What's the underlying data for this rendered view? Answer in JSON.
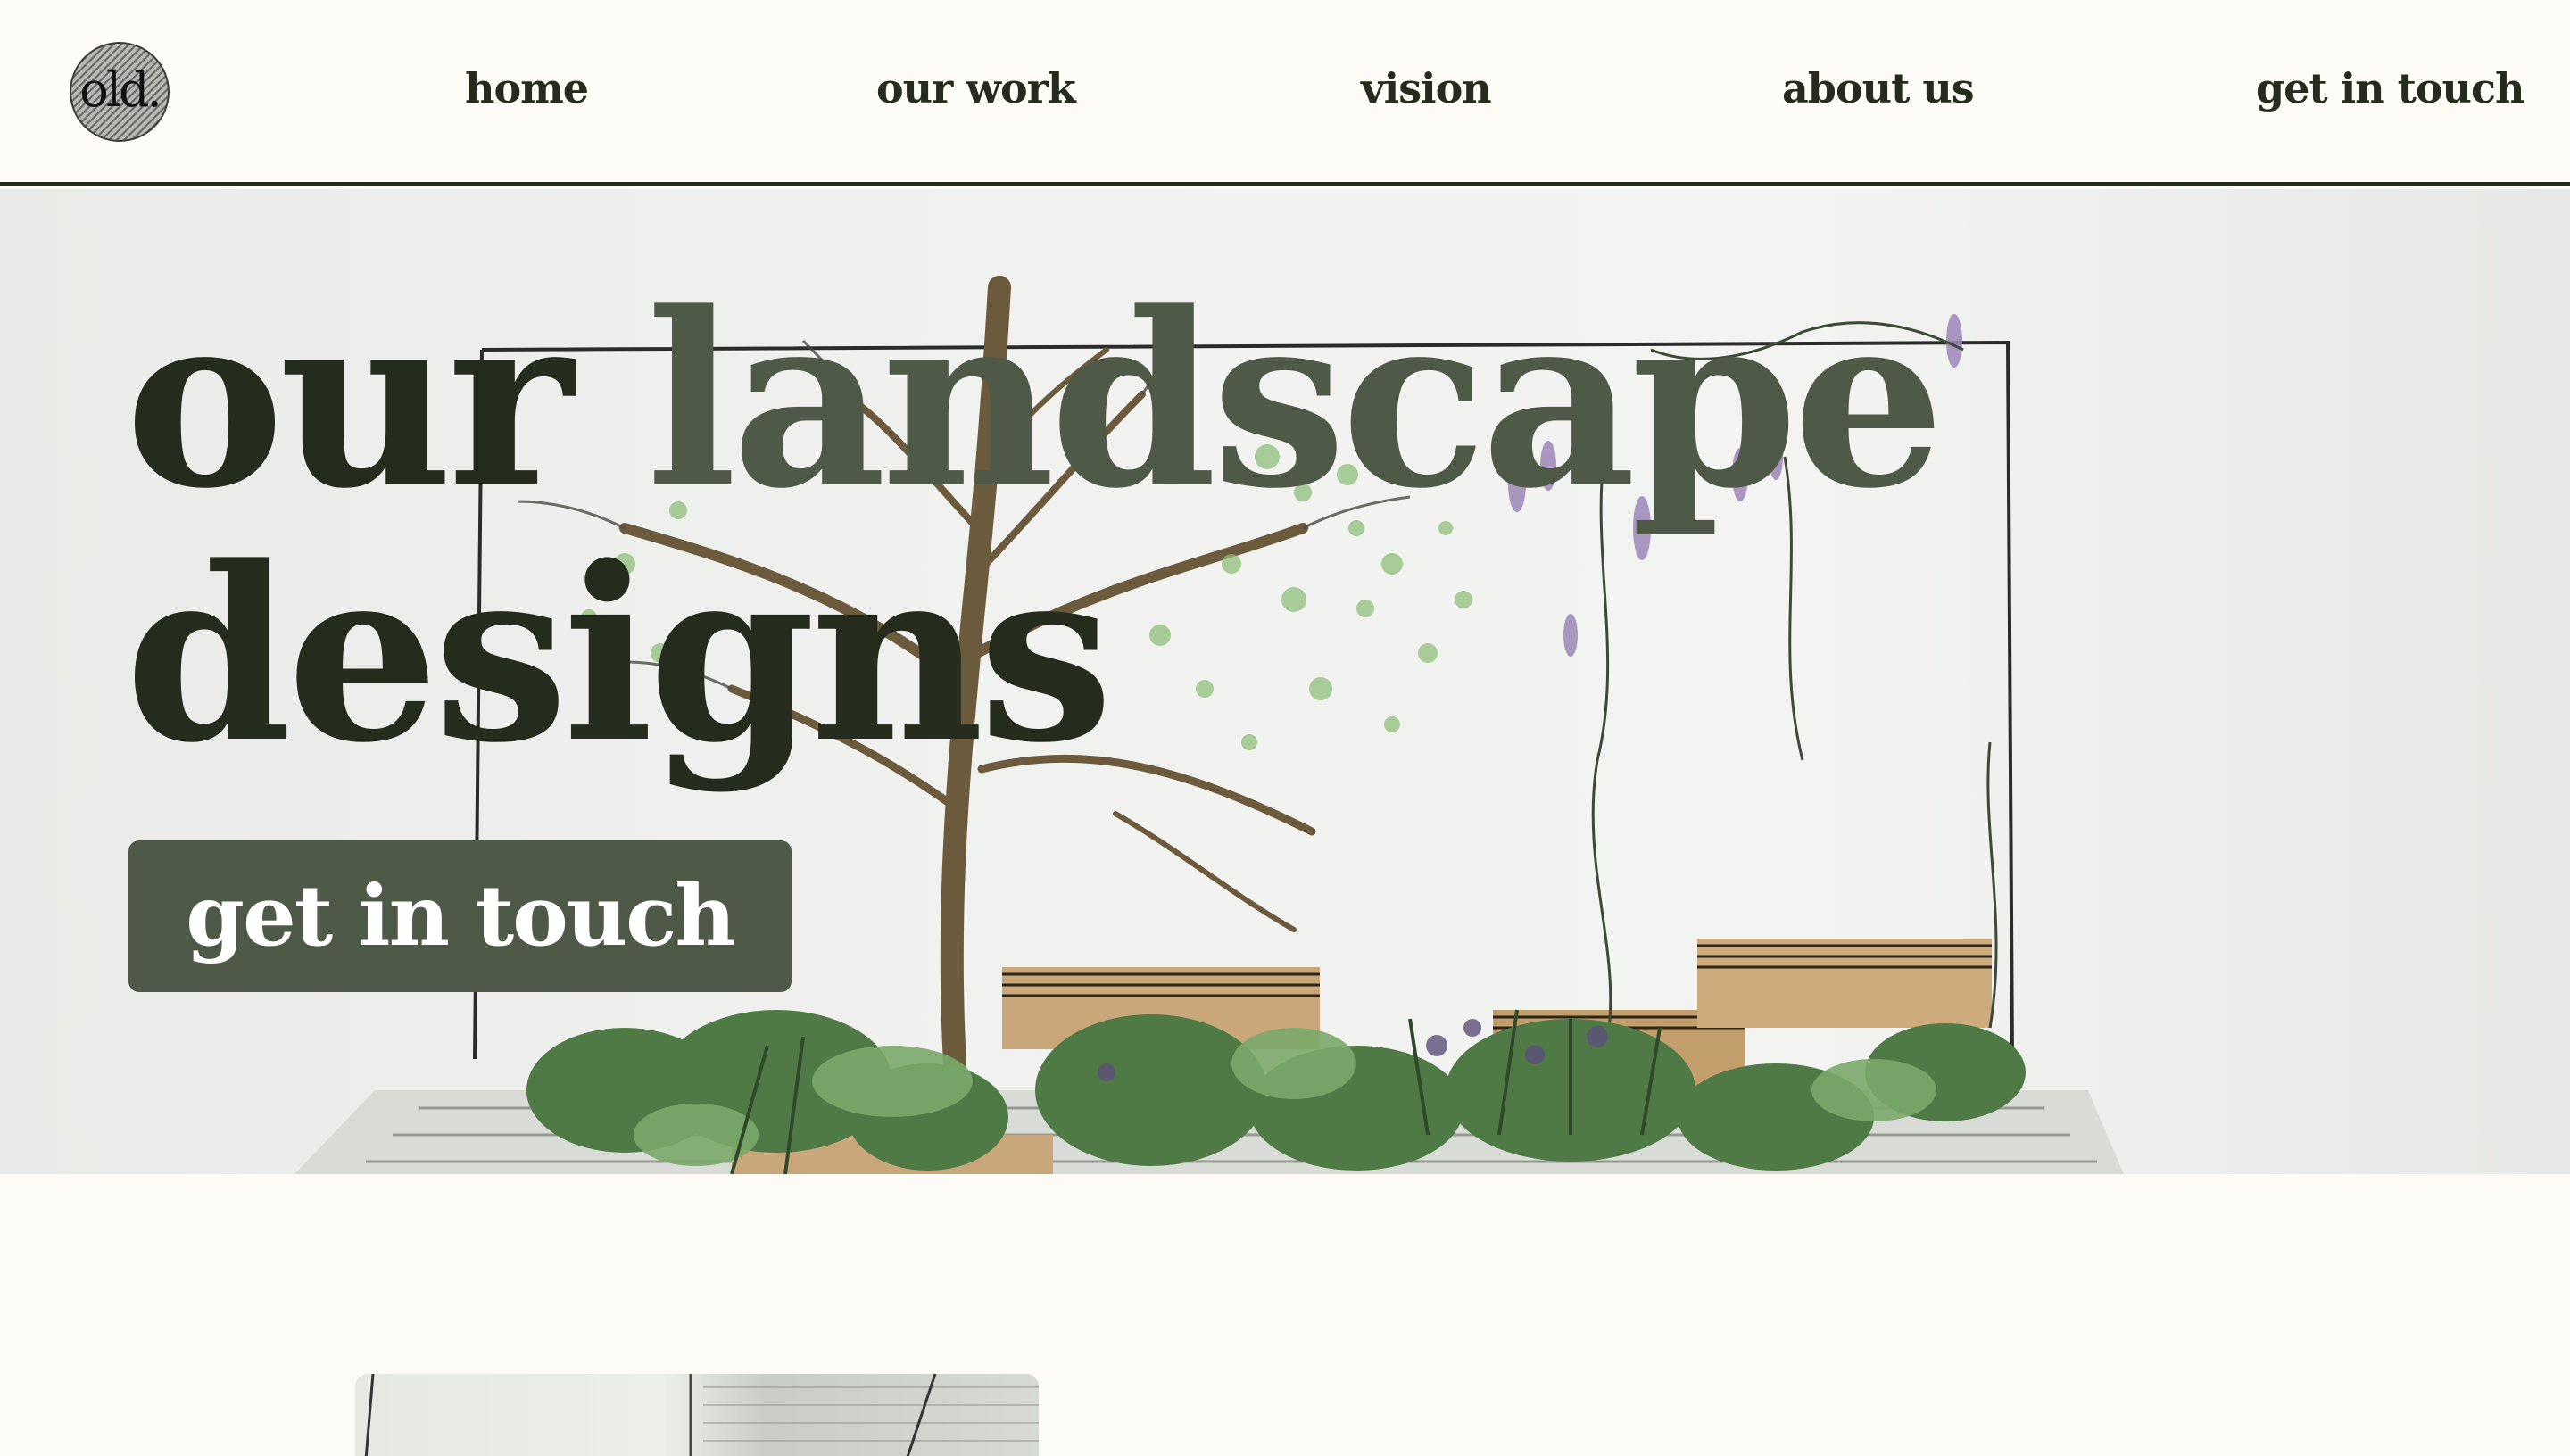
{
  "header": {
    "logo_text": "old.",
    "nav": {
      "home": "home",
      "our_work": "our work",
      "vision": "vision",
      "about_us": "about us",
      "get_in_touch": "get in touch"
    }
  },
  "hero": {
    "headline_part1": "our ",
    "headline_part2": "landscape",
    "headline_line2": "designs",
    "cta_label": "get in touch"
  },
  "colors": {
    "background": "#fdfbf6",
    "text_dark": "#262c1d",
    "accent_green": "#4f5947",
    "cta_text": "#ffffff"
  }
}
